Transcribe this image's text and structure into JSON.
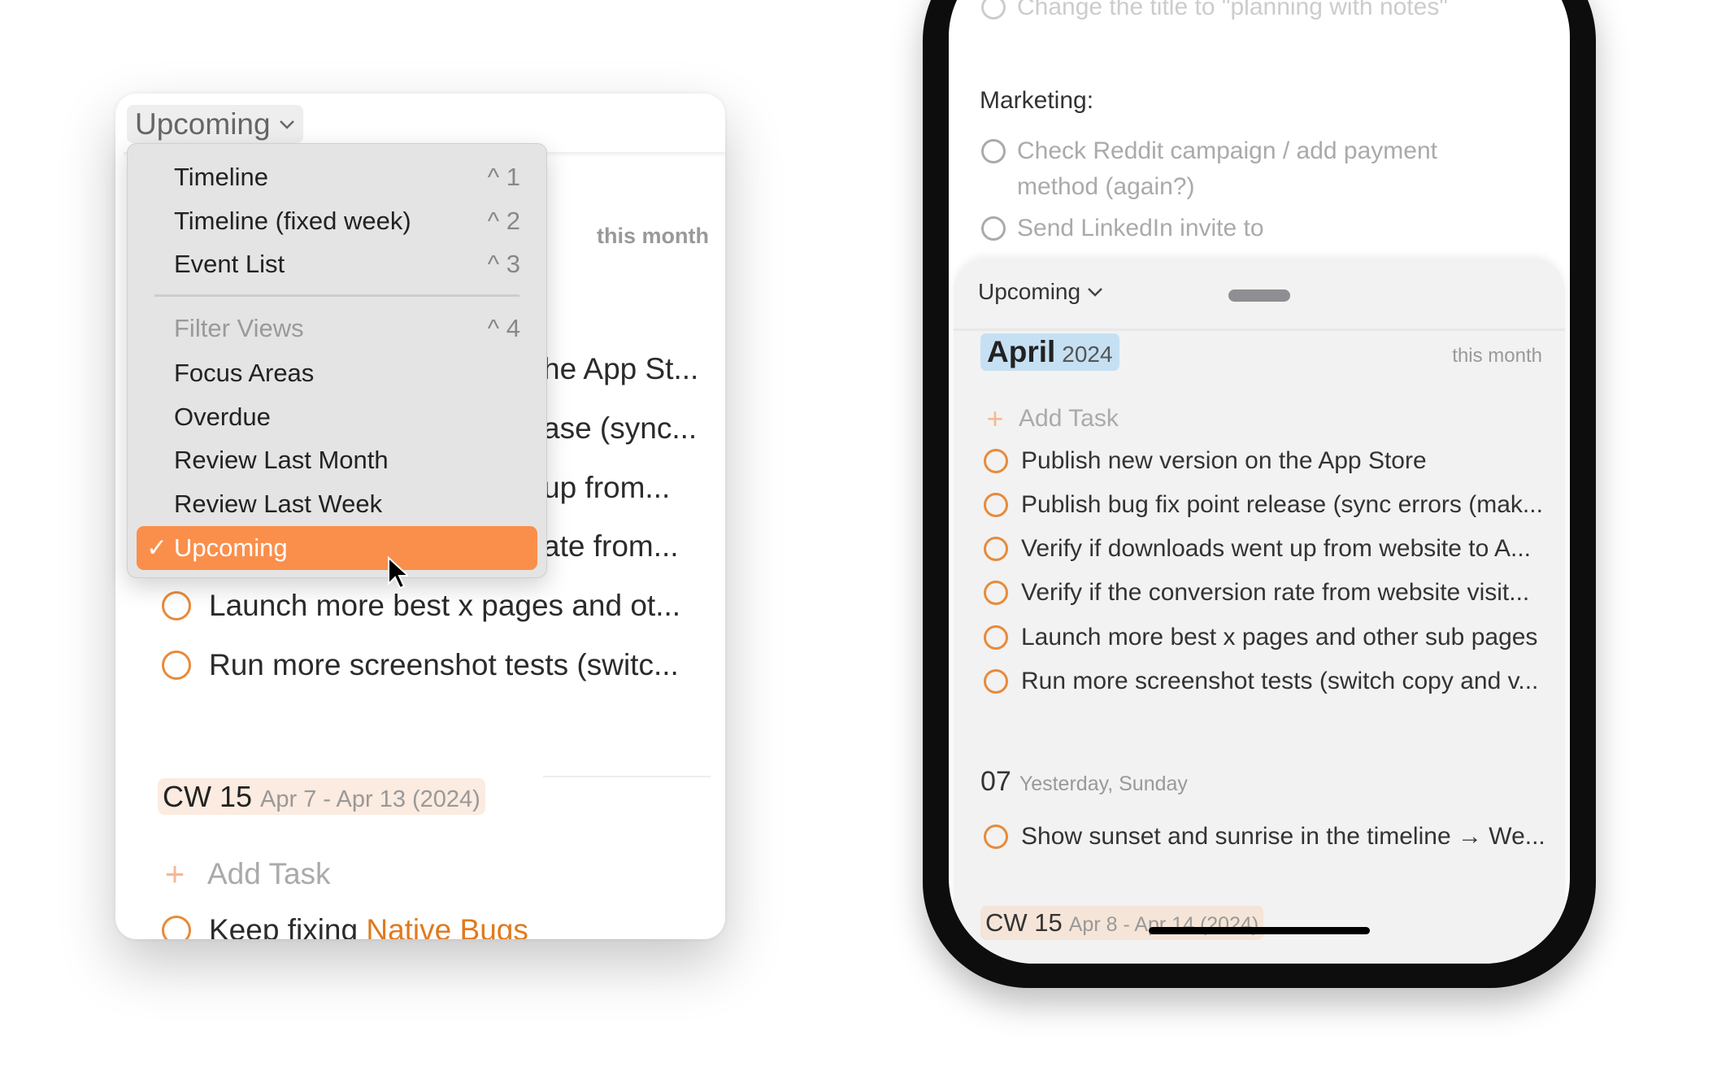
{
  "colors": {
    "accent": "#fa8f4c",
    "task_circle": "#e88a3a",
    "month_badge": "#c6e0f3",
    "week_badge": "#fbebe0"
  },
  "mac": {
    "view_selector": {
      "label": "Upcoming",
      "icon": "chevron-down-icon"
    },
    "this_month": "this month",
    "tasks": [
      "he App St...",
      "ase (sync...",
      "up from...",
      "ate from...",
      "Launch more best x pages and ot...",
      "Run more screenshot tests (switc..."
    ],
    "week": {
      "label": "CW 15",
      "range": "Apr 7 - Apr 13 (2024)"
    },
    "add_task": "Add Task",
    "partial_task": {
      "text": "Keep fixing ",
      "link": "Native Bugs"
    },
    "menu": {
      "items": [
        {
          "label": "Timeline",
          "shortcut": "^ 1"
        },
        {
          "label": "Timeline (fixed week)",
          "shortcut": "^ 2"
        },
        {
          "label": "Event List",
          "shortcut": "^ 3"
        }
      ],
      "section": {
        "label": "Filter Views",
        "shortcut": "^ 4"
      },
      "filter_items": [
        "Focus Areas",
        "Overdue",
        "Review Last Month",
        "Review Last Week"
      ],
      "selected": {
        "label": "Upcoming",
        "check": "✓"
      }
    }
  },
  "phone": {
    "note": {
      "top_item": "Change the title to \"planning with notes\"",
      "heading": "Marketing:",
      "items": [
        "Check Reddit campaign / add payment method (again?)",
        "Send LinkedIn invite to"
      ]
    },
    "sheet": {
      "view_selector": "Upcoming",
      "month": "April",
      "year": "2024",
      "this_month": "this month",
      "add_task": "Add Task",
      "tasks": [
        "Publish new version on the App Store",
        "Publish bug fix point release (sync errors (mak...",
        "Verify if downloads went up from website to A...",
        "Verify if the conversion rate from website visit...",
        "Launch more best x pages and other sub pages",
        "Run more screenshot tests (switch copy and v..."
      ],
      "day": {
        "num": "07",
        "label": "Yesterday, Sunday"
      },
      "day_tasks": [
        "Show sunset and sunrise in the timeline → We..."
      ],
      "week": {
        "label": "CW 15",
        "range": "Apr 8 - Apr 14 (2024)"
      }
    }
  }
}
